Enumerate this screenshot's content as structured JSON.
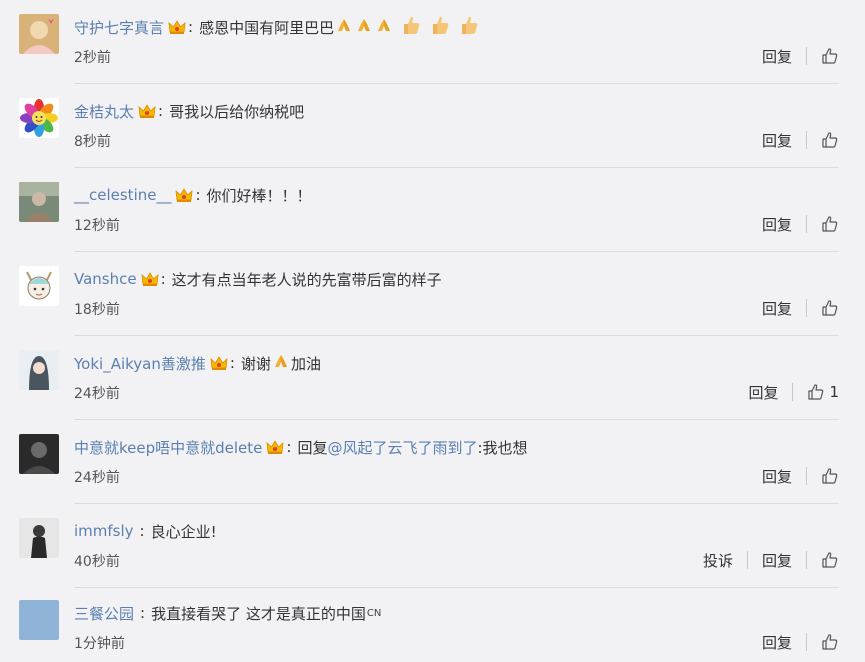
{
  "comments": [
    {
      "user": "守护七字真言",
      "text": "感恩中国有阿里巴巴",
      "emojis": [
        "pray",
        "pray",
        "pray",
        "thumb",
        "thumb",
        "thumb"
      ],
      "time": "2秒前",
      "reply": "回复",
      "likes": "",
      "avatar": {
        "kind": "photo",
        "bg": "#d9b27a",
        "fg": "#f0d8b0"
      }
    },
    {
      "user": "金桔丸太",
      "text": "哥我以后给你纳税吧",
      "time": "8秒前",
      "reply": "回复",
      "likes": "",
      "avatar": {
        "kind": "flower",
        "bg": "#ffffff"
      }
    },
    {
      "user": "__celestine__",
      "text": "你们好棒！！！",
      "time": "12秒前",
      "reply": "回复",
      "likes": "",
      "avatar": {
        "kind": "photo",
        "bg": "#7a8a78",
        "fg": "#c9b9a4"
      }
    },
    {
      "user": "Vanshce",
      "text": "这才有点当年老人说的先富带后富的样子",
      "time": "18秒前",
      "reply": "回复",
      "likes": "",
      "avatar": {
        "kind": "cartoon",
        "bg": "#ffffff"
      }
    },
    {
      "user": "Yoki_Aikyan善激推",
      "text": "谢谢",
      "text_after": "加油",
      "mid_emoji": "pray",
      "time": "24秒前",
      "reply": "回复",
      "likes": "1",
      "avatar": {
        "kind": "photo",
        "bg": "#e8eef2",
        "fg": "#4a5560"
      }
    },
    {
      "user": "中意就keep唔中意就delete",
      "text": "回复",
      "mention": "@风起了云飞了雨到了",
      "text_after": ":我也想",
      "time": "24秒前",
      "reply": "回复",
      "likes": "",
      "avatar": {
        "kind": "photo",
        "bg": "#2a2a2a",
        "fg": "#6a6a6a"
      }
    },
    {
      "user": "immfsly",
      "text": "良心企业!",
      "time": "40秒前",
      "report": "投诉",
      "reply": "回复",
      "likes": "",
      "no_crown": true,
      "avatar": {
        "kind": "photo",
        "bg": "#e6e6e6",
        "fg": "#3a3a3a"
      }
    },
    {
      "user": "三餐公园",
      "text": "我直接看哭了 这才是真正的中国",
      "suffix": "CN",
      "time": "1分钟前",
      "reply": "回复",
      "likes": "",
      "no_crown": true,
      "avatar": {
        "kind": "solid",
        "bg": "#8fb4d8"
      }
    }
  ],
  "colors": {
    "background": "#f2f2f5",
    "username": "#5b7fb0",
    "divider": "#dcdce0"
  }
}
